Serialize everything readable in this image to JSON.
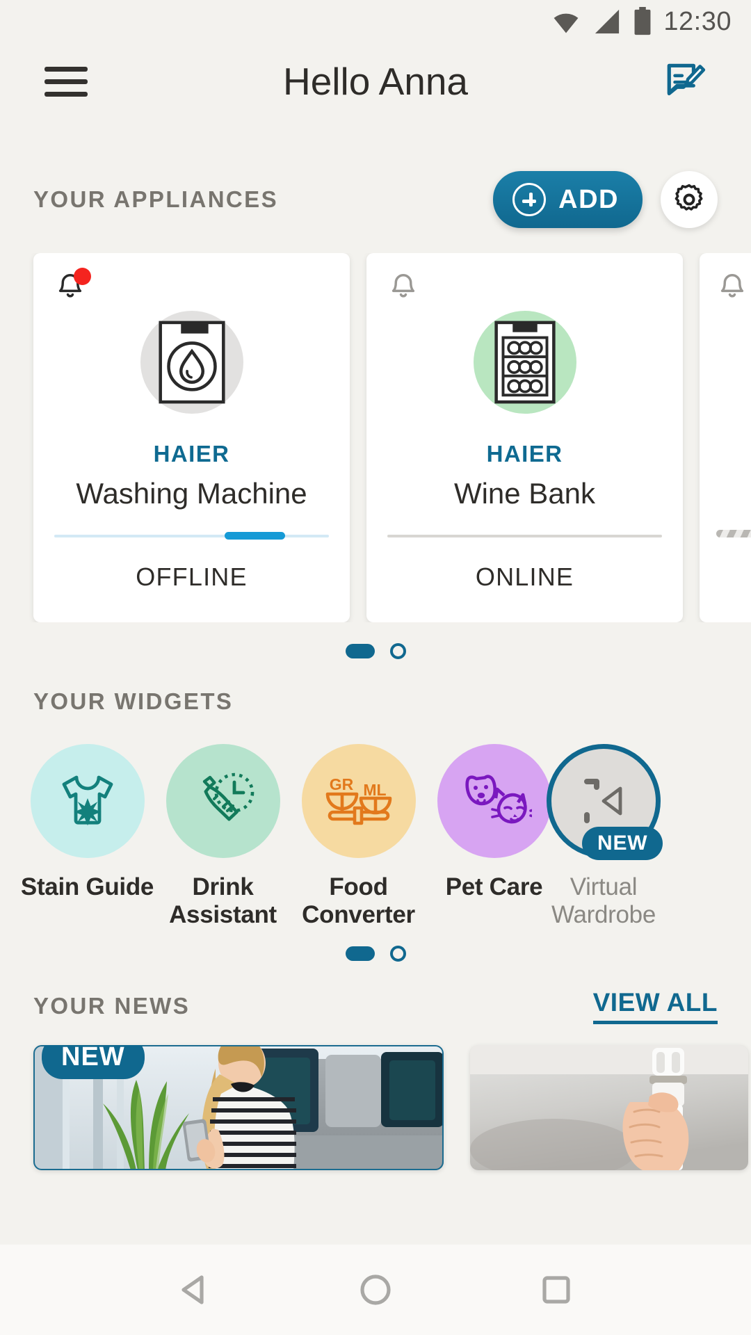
{
  "statusbar": {
    "time": "12:30",
    "icons": [
      "wifi-icon",
      "cellular-signal-icon",
      "battery-icon"
    ]
  },
  "header": {
    "menu_icon": "hamburger-menu-icon",
    "title": "Hello Anna",
    "compose_icon": "message-compose-icon"
  },
  "appliances": {
    "section_title": "YOUR APPLIANCES",
    "add_label": "ADD",
    "settings_icon": "gear-icon",
    "cards": [
      {
        "brand": "HAIER",
        "name": "Washing Machine",
        "status": "OFFLINE",
        "icon": "washing-machine-icon",
        "icon_bg": "#e0e0e0",
        "has_alert": true,
        "progress": true
      },
      {
        "brand": "HAIER",
        "name": "Wine Bank",
        "status": "ONLINE",
        "icon": "wine-cooler-icon",
        "icon_bg": "#b9e6c0",
        "has_alert": false,
        "progress": false
      }
    ],
    "pagination": {
      "active": 1,
      "total": 2
    }
  },
  "widgets": {
    "section_title": "YOUR WIDGETS",
    "items": [
      {
        "label": "Stain Guide",
        "icon": "tshirt-stain-icon",
        "bg": "#c6eeec",
        "fg": "#13807c",
        "badge": null
      },
      {
        "label": "Drink Assistant",
        "icon": "bottle-clock-icon",
        "bg": "#b6e3cd",
        "fg": "#127a5a",
        "badge": null
      },
      {
        "label": "Food Converter",
        "icon": "balance-scale-icon",
        "bg": "#f6daa1",
        "fg": "#e2791c",
        "badge": null
      },
      {
        "label": "Pet Care",
        "icon": "dog-cat-icon",
        "bg": "#d7a4f2",
        "fg": "#7a18bf",
        "badge": null
      },
      {
        "label": "Virtual Wardrobe",
        "icon": "wardrobe-icon",
        "bg": "#dedcd9",
        "fg": "#6d6b67",
        "badge": "NEW"
      }
    ],
    "scale_labels": {
      "left": "GR",
      "right": "ML"
    },
    "pagination": {
      "active": 1,
      "total": 2
    }
  },
  "news": {
    "section_title": "YOUR NEWS",
    "view_all_label": "VIEW ALL",
    "cards": [
      {
        "badge": "NEW",
        "image": "woman-with-phone-on-sofa-photo"
      },
      {
        "badge": null,
        "image": "hand-holding-lightbulb-photo"
      }
    ]
  },
  "navbar": {
    "back_icon": "back-triangle-icon",
    "home_icon": "home-circle-icon",
    "recents_icon": "recents-square-icon"
  }
}
